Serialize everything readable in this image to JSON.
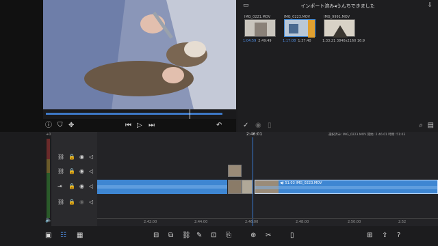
{
  "browser": {
    "title": "インポート済み◂うんちできました",
    "clips": [
      {
        "name": "IMG_0221.MOV",
        "duration": "1:04:59",
        "info": "2:49:49"
      },
      {
        "name": "IMG_0223.MOV",
        "duration": "1:17:08",
        "info": "1:37:40"
      },
      {
        "name": "IMG_9991.MOV",
        "duration": "",
        "info": "1:33:21  3840x2160  16:9"
      }
    ]
  },
  "timeline": {
    "playhead_time": "2:46:01",
    "status": "選択済み: IMG_0223.MOV 開始: 2:46:01 時間: 51:03",
    "meter_top": "+0",
    "main_clip_label": "◀) 51:03  IMG_0223.MOV",
    "ruler_ticks": [
      "2:42:00",
      "2:44:00",
      "2:46:00",
      "2:48:00",
      "2:50:00",
      "2:52"
    ]
  },
  "icons": {
    "folder": "folder-icon",
    "export": "export-icon",
    "info": "info-icon",
    "trim": "trim-icon",
    "move": "move-icon",
    "prev": "previous-icon",
    "play": "play-icon",
    "next": "next-icon",
    "undo": "undo-icon",
    "check": "check-icon",
    "zoom": "zoom-icon",
    "filter": "filter-icon"
  },
  "colors": {
    "accent": "#3e86d2",
    "background": "#1c1c1e",
    "timeline": "#2a2a2d"
  }
}
